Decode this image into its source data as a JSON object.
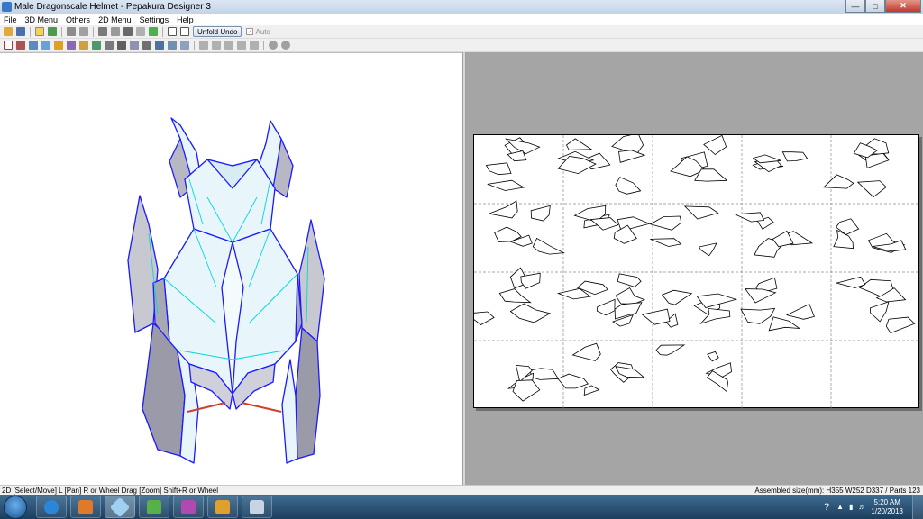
{
  "window": {
    "title": "Male Dragonscale Helmet - Pepakura Designer 3"
  },
  "menu": [
    "File",
    "3D Menu",
    "Others",
    "2D Menu",
    "Settings",
    "Help"
  ],
  "toolbar": {
    "unfold_undo_label": "Unfold Undo",
    "auto_label": "Auto",
    "auto_checked": true
  },
  "status": {
    "left": "2D [Select/Move] L [Pan] R or Wheel Drag [Zoom] Shift+R or Wheel",
    "right": "Assembled size(mm): H355 W252 D337 / Parts 123"
  },
  "taskbar": {
    "apps": [
      "Internet Explorer",
      "Blender",
      "Pepakura Designer",
      "Notepad++",
      "Games",
      "Paint",
      "Calculator"
    ],
    "time": "5:20 AM",
    "date": "1/20/2013"
  },
  "colors": {
    "model_edge": "#1a1aff",
    "model_fold": "#00d8d8",
    "model_fill": "#e8f6fb",
    "model_shade": "#8f8f9e",
    "pane2d_bg": "#a5a5a5",
    "accent_red": "#d0402a"
  }
}
